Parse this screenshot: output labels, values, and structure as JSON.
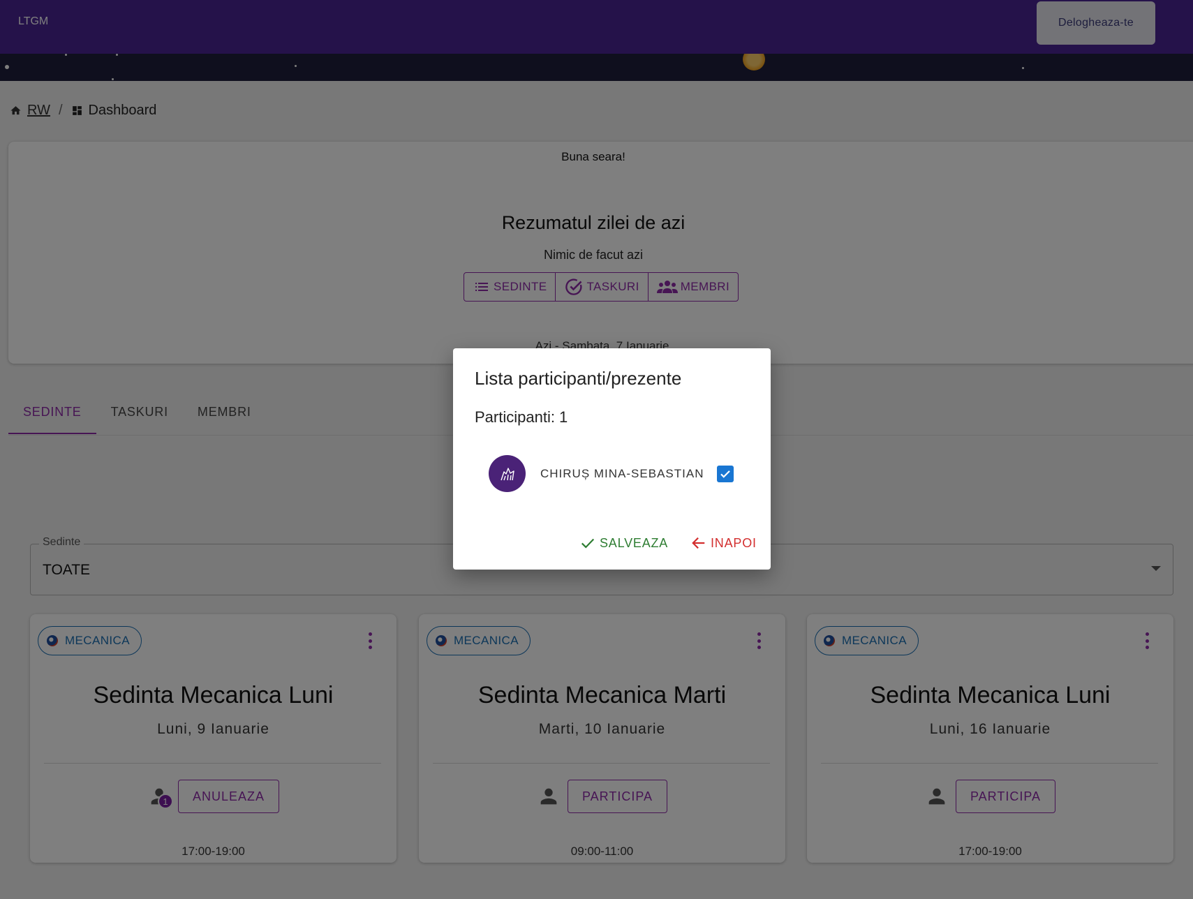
{
  "appbar": {
    "brand": "LTGM",
    "logout_label": "Delogheaza-te"
  },
  "breadcrumb": {
    "root": "RW",
    "separator": "/",
    "current": "Dashboard"
  },
  "summary": {
    "greeting": "Buna seara!",
    "title": "Rezumatul zilei de azi",
    "status": "Nimic de facut azi",
    "buttons": {
      "sedinte": "SEDINTE",
      "taskuri": "TASKURI",
      "membri": "MEMBRI"
    },
    "today_label": "Azi - Sambata, 7 Ianuarie"
  },
  "tabs": [
    {
      "label": "SEDINTE",
      "active": true
    },
    {
      "label": "TASKURI",
      "active": false
    },
    {
      "label": "MEMBRI",
      "active": false
    }
  ],
  "filter": {
    "label": "Sedinte",
    "value": "TOATE"
  },
  "meetings": [
    {
      "category": "MECANICA",
      "title": "Sedinta Mecanica Luni",
      "date": "Luni, 9 Ianuarie",
      "action": "ANULEAZA",
      "participants": "1",
      "time": "17:00-19:00"
    },
    {
      "category": "MECANICA",
      "title": "Sedinta Mecanica Marti",
      "date": "Marti, 10 Ianuarie",
      "action": "PARTICIPA",
      "participants": "",
      "time": "09:00-11:00"
    },
    {
      "category": "MECANICA",
      "title": "Sedinta Mecanica Luni",
      "date": "Luni, 16 Ianuarie",
      "action": "PARTICIPA",
      "participants": "",
      "time": "17:00-19:00"
    }
  ],
  "dialog": {
    "title": "Lista participanti/prezente",
    "count_label": "Participanti: 1",
    "participants": [
      {
        "name": "CHIRUȘ MINA-SEBASTIAN",
        "present": true
      }
    ],
    "save_label": "SALVEAZA",
    "back_label": "INAPOI"
  },
  "colors": {
    "primary": "#8e2aa8",
    "appbar": "#4a2494",
    "chip": "#1a6fb3",
    "save": "#2e7d32",
    "back": "#d32f2f"
  }
}
